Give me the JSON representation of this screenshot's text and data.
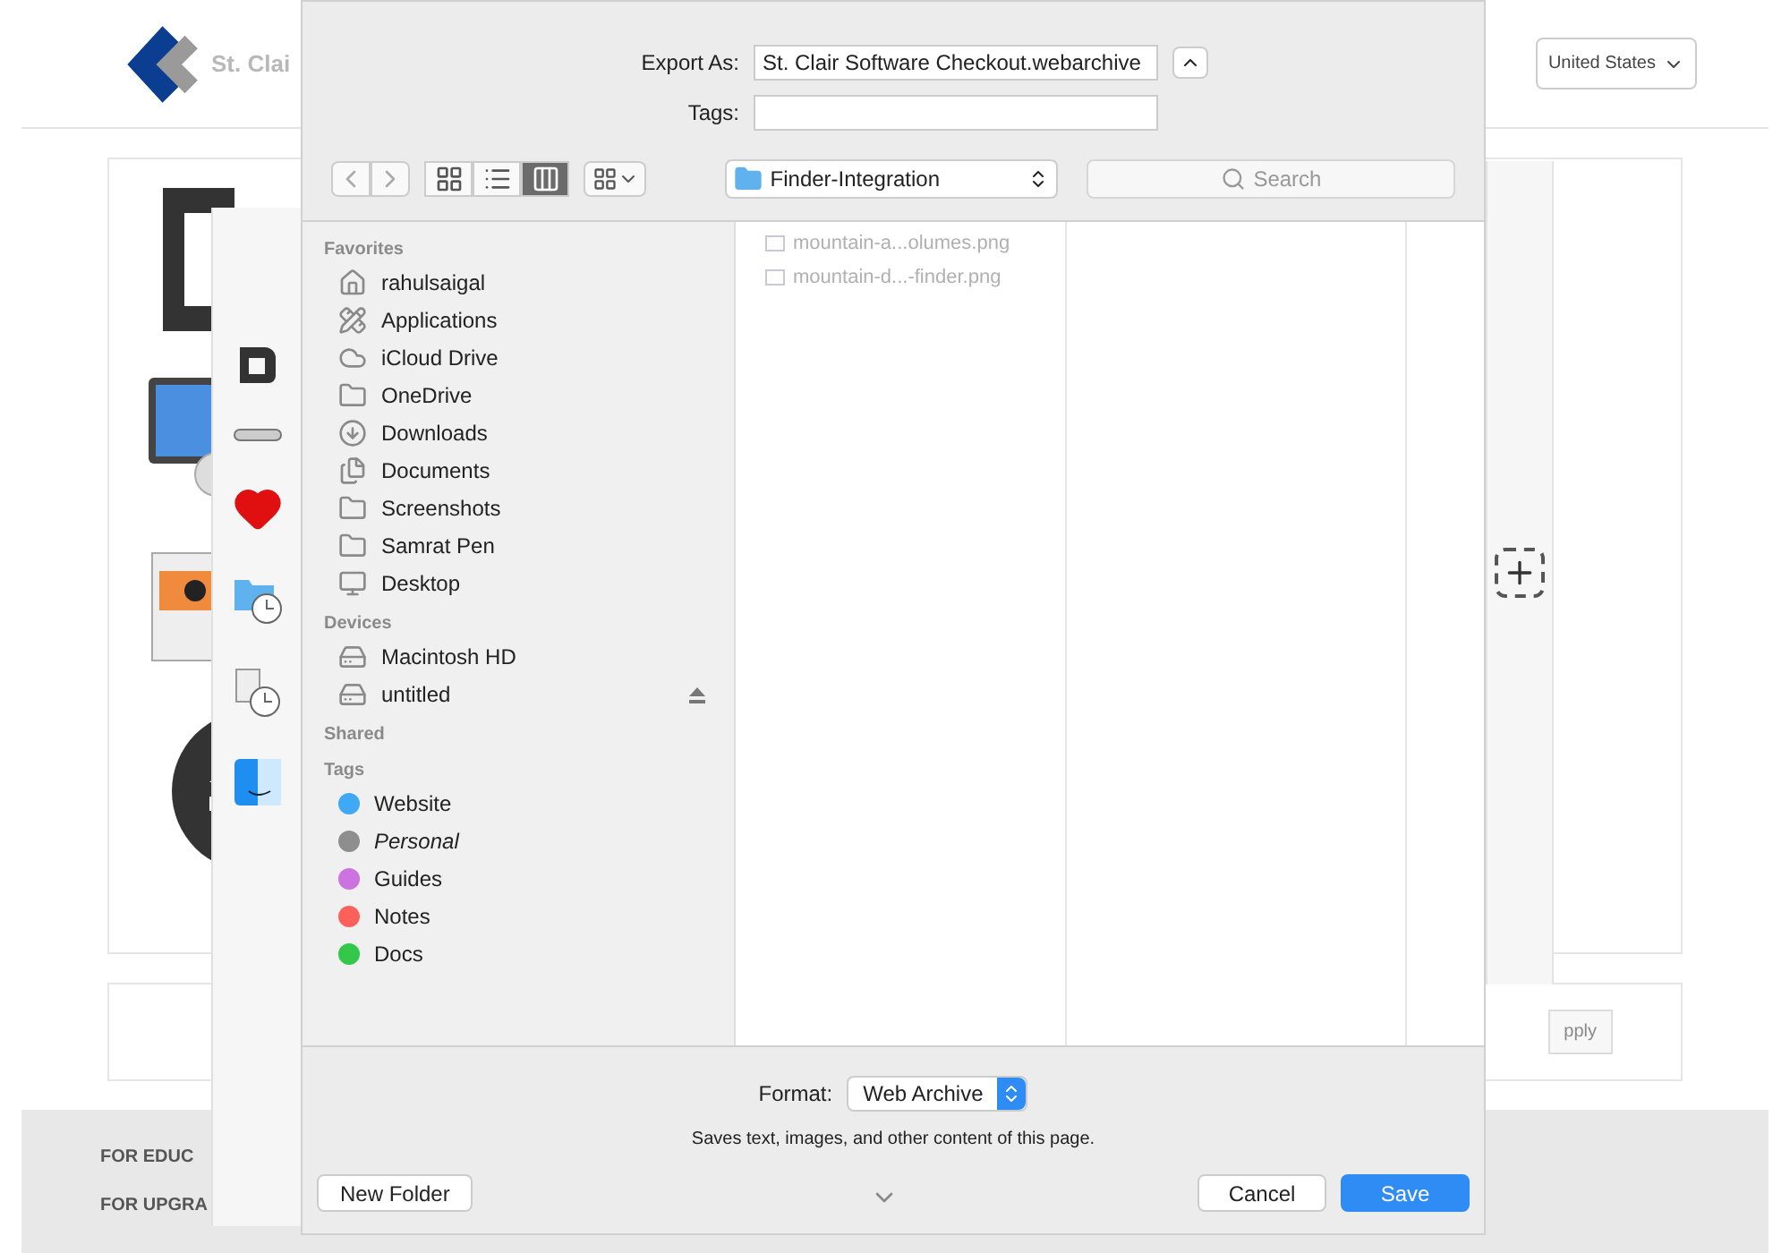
{
  "page": {
    "logo_text": "St. Clai",
    "region": "United States",
    "footer_lines": [
      "FOR EDUC",
      "FOR UPGRA"
    ],
    "apply": "pply"
  },
  "dialog": {
    "export_label": "Export As:",
    "filename": "St. Clair Software Checkout.webarchive",
    "tags_label": "Tags:",
    "view_modes": [
      {
        "kind": "icons",
        "selected": false
      },
      {
        "kind": "list",
        "selected": false
      },
      {
        "kind": "columns",
        "selected": true
      }
    ],
    "location": "Finder-Integration",
    "search_placeholder": "Search",
    "sidebar": [
      {
        "heading": "Favorites",
        "items": [
          {
            "label": "rahulsaigal",
            "kind": "home"
          },
          {
            "label": "Applications",
            "kind": "apps"
          },
          {
            "label": "iCloud Drive",
            "kind": "cloud"
          },
          {
            "label": "OneDrive",
            "kind": "folder"
          },
          {
            "label": "Downloads",
            "kind": "download"
          },
          {
            "label": "Documents",
            "kind": "documents"
          },
          {
            "label": "Screenshots",
            "kind": "folder"
          },
          {
            "label": "Samrat Pen",
            "kind": "folder"
          },
          {
            "label": "Desktop",
            "kind": "desktop"
          }
        ]
      },
      {
        "heading": "Devices",
        "items": [
          {
            "label": "Macintosh HD",
            "kind": "disk"
          },
          {
            "label": "untitled",
            "kind": "disk",
            "ejectable": true
          }
        ]
      },
      {
        "heading": "Shared"
      },
      {
        "heading": "Tags",
        "items": [
          {
            "label": "Website",
            "color": "#3fa9f5"
          },
          {
            "label": "Personal",
            "color": "#8e8e8e",
            "italic": true
          },
          {
            "label": "Guides",
            "color": "#cc73e1"
          },
          {
            "label": "Notes",
            "color": "#fc605b"
          },
          {
            "label": "Docs",
            "color": "#34c84a"
          }
        ]
      }
    ],
    "files": [
      "mountain-a...olumes.png",
      "mountain-d...-finder.png"
    ],
    "format_label": "Format:",
    "format": "Web Archive",
    "format_note": "Saves text, images, and other content of this page.",
    "new_folder": "New Folder",
    "cancel": "Cancel",
    "save": "Save"
  }
}
